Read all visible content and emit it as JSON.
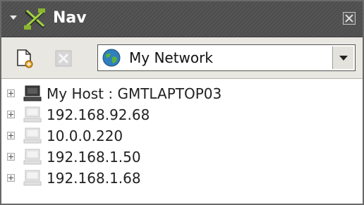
{
  "panel": {
    "title": "Nav",
    "title_color": "#ffffff",
    "header_bg": "#4d4d4d"
  },
  "toolbar": {
    "new_icon": "new-document-icon",
    "delete_icon": "delete-icon",
    "network_select": {
      "selected": "My Network",
      "icon": "globe-icon"
    }
  },
  "tree": {
    "items": [
      {
        "label": "My Host : GMTLAPTOP03",
        "icon": "computer-icon"
      },
      {
        "label": "192.168.92.68",
        "icon": "computer-disabled-icon"
      },
      {
        "label": "10.0.0.220",
        "icon": "computer-disabled-icon"
      },
      {
        "label": "192.168.1.50",
        "icon": "computer-disabled-icon"
      },
      {
        "label": "192.168.1.68",
        "icon": "computer-disabled-icon"
      }
    ]
  }
}
